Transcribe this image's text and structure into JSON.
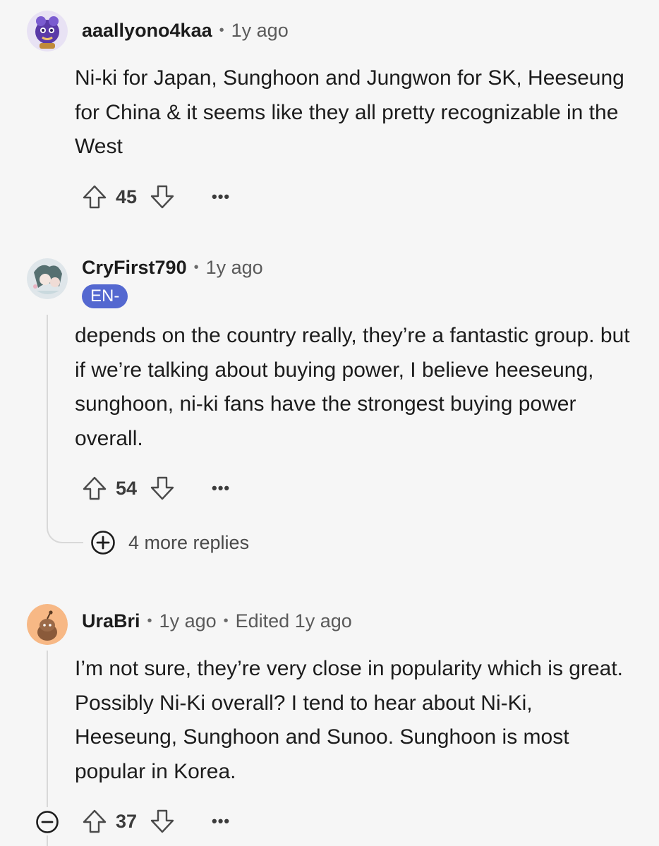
{
  "comments": [
    {
      "username": "aaallyono4kaa",
      "time": "1y ago",
      "body": "Ni-ki for Japan, Sunghoon and Jungwon for SK, Heeseung for China & it seems like they all pretty recognizable in the West",
      "score": "45",
      "more_label": "•••"
    },
    {
      "username": "CryFirst790",
      "time": "1y ago",
      "flair": "EN-",
      "body": "depends on the country really, they’re a fantastic group. but if we’re talking about buying power, I believe heeseung, sunghoon, ni-ki fans have the strongest buying power overall.",
      "score": "54",
      "more_label": "•••",
      "more_replies_label": "4 more replies"
    },
    {
      "username": "UraBri",
      "time": "1y ago",
      "edited": "Edited 1y ago",
      "body": "I’m not sure, they’re very close in popularity which is great. Possibly Ni-Ki overall? I tend to hear about Ni-Ki, Heeseung, Sunghoon and Sunoo. Sunghoon is most popular in Korea.",
      "score": "37",
      "more_label": "•••"
    }
  ],
  "separator": "•",
  "colors": {
    "background": "#f6f6f6",
    "flair_bg": "#5468d0",
    "text": "#1c1c1c",
    "meta": "#5a5a5a",
    "thread_line": "#d8d8d8"
  }
}
